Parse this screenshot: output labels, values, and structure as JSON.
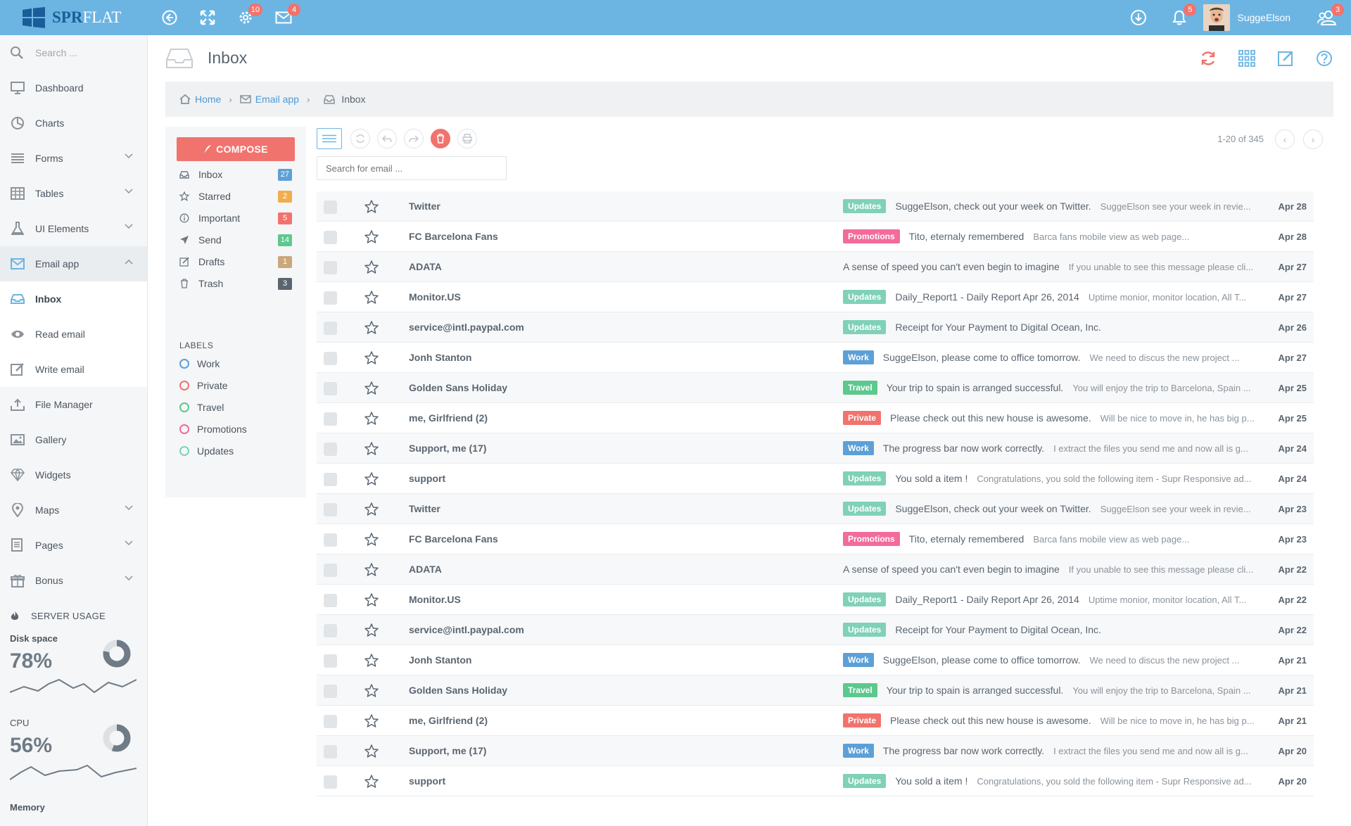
{
  "brand": {
    "part1": "SPR",
    "part2": "FLAT"
  },
  "topbar": {
    "badges": {
      "settings": "10",
      "mail": "4",
      "bell": "5",
      "users": "3"
    },
    "username": "SuggeElson",
    "icons": [
      "back-icon",
      "fullscreen-icon",
      "gear-icon",
      "envelope-icon",
      "download-icon",
      "bell-icon",
      "users-icon"
    ]
  },
  "sidebar": {
    "search_placeholder": "Search ...",
    "items": [
      {
        "label": "Dashboard",
        "icon": "monitor-icon"
      },
      {
        "label": "Charts",
        "icon": "pie-chart-icon"
      },
      {
        "label": "Forms",
        "icon": "list-icon"
      },
      {
        "label": "Tables",
        "icon": "table-icon"
      },
      {
        "label": "UI Elements",
        "icon": "flask-icon"
      },
      {
        "label": "Email app",
        "icon": "envelope-icon"
      }
    ],
    "email_sub": [
      {
        "label": "Inbox",
        "icon": "inbox-icon"
      },
      {
        "label": "Read email",
        "icon": "eye-icon"
      },
      {
        "label": "Write email",
        "icon": "pencil-icon"
      }
    ],
    "items2": [
      {
        "label": "File Manager",
        "icon": "upload-icon"
      },
      {
        "label": "Gallery",
        "icon": "picture-icon"
      },
      {
        "label": "Widgets",
        "icon": "diamond-icon"
      },
      {
        "label": "Maps",
        "icon": "map-pin-icon"
      },
      {
        "label": "Pages",
        "icon": "pages-icon"
      },
      {
        "label": "Bonus",
        "icon": "gift-icon"
      }
    ],
    "server": {
      "title": "SERVER USAGE",
      "disk": {
        "label": "Disk space",
        "pct": "78%",
        "value": 0.78
      },
      "cpu": {
        "label": "CPU",
        "pct": "56%",
        "value": 0.56
      },
      "memory": {
        "label": "Memory"
      }
    }
  },
  "page": {
    "title": "Inbox"
  },
  "breadcrumb": {
    "home": "Home",
    "email": "Email app",
    "current": "Inbox"
  },
  "mailnav": {
    "compose": "COMPOSE",
    "folders": [
      {
        "label": "Inbox",
        "count": "27",
        "color": "#5da0d7",
        "icon": "inbox-icon"
      },
      {
        "label": "Starred",
        "count": "2",
        "color": "#f0ad4e",
        "icon": "star-icon"
      },
      {
        "label": "Important",
        "count": "5",
        "color": "#f1736e",
        "icon": "info-icon"
      },
      {
        "label": "Send",
        "count": "14",
        "color": "#5cc88e",
        "icon": "send-icon"
      },
      {
        "label": "Drafts",
        "count": "1",
        "color": "#c9a87c",
        "icon": "draft-icon"
      },
      {
        "label": "Trash",
        "count": "3",
        "color": "#5a6570",
        "icon": "trash-icon"
      }
    ],
    "labels_title": "LABELS",
    "labels": [
      {
        "label": "Work",
        "color": "#5da0d7"
      },
      {
        "label": "Private",
        "color": "#f1736e"
      },
      {
        "label": "Travel",
        "color": "#5cc88e"
      },
      {
        "label": "Promotions",
        "color": "#f26b9b"
      },
      {
        "label": "Updates",
        "color": "#7fd1b7"
      }
    ]
  },
  "toolbar": {
    "pager": "1-20 of 345",
    "search_placeholder": "Search for email ..."
  },
  "tag_colors": {
    "Updates": "#7fd1b7",
    "Promotions": "#f26b9b",
    "Work": "#5da0d7",
    "Travel": "#5cc88e",
    "Private": "#f1736e"
  },
  "emails": [
    {
      "from": "Twitter",
      "tag": "Updates",
      "subject": "SuggeElson, check out your week on Twitter.",
      "preview": "SuggeElson see your week in revie...",
      "date": "Apr 28"
    },
    {
      "from": "FC Barcelona Fans",
      "tag": "Promotions",
      "subject": "Tito, eternaly remembered",
      "preview": "Barca fans mobile view as web page...",
      "date": "Apr 28"
    },
    {
      "from": "ADATA",
      "tag": "",
      "subject": "A sense of speed you can't even begin to imagine",
      "preview": "If you unable to see this message please cli...",
      "date": "Apr 27"
    },
    {
      "from": "Monitor.US",
      "tag": "Updates",
      "subject": "Daily_Report1 - Daily Report Apr 26, 2014",
      "preview": "Uptime monior, monitor location, All T...",
      "date": "Apr 27"
    },
    {
      "from": "service@intl.paypal.com",
      "tag": "Updates",
      "subject": "Receipt for Your Payment to Digital Ocean, Inc.",
      "preview": "",
      "date": "Apr 26"
    },
    {
      "from": "Jonh Stanton",
      "tag": "Work",
      "subject": "SuggeElson, please come to office tomorrow.",
      "preview": "We need to discus the new project ...",
      "date": "Apr 27"
    },
    {
      "from": "Golden Sans Holiday",
      "tag": "Travel",
      "subject": "Your trip to spain is arranged successful.",
      "preview": "You will enjoy the trip to Barcelona, Spain ...",
      "date": "Apr 25"
    },
    {
      "from": "me, Girlfriend (2)",
      "tag": "Private",
      "subject": "Please check out this new house is awesome.",
      "preview": "Will be nice to move in, he has big p...",
      "date": "Apr 25"
    },
    {
      "from": "Support, me (17)",
      "tag": "Work",
      "subject": "The progress bar now work correctly.",
      "preview": "I extract the files you send me and now all is g...",
      "date": "Apr 24"
    },
    {
      "from": "support",
      "tag": "Updates",
      "subject": "You sold a item !",
      "preview": "Congratulations, you sold the following item - Supr Responsive ad...",
      "date": "Apr 24"
    },
    {
      "from": "Twitter",
      "tag": "Updates",
      "subject": "SuggeElson, check out your week on Twitter.",
      "preview": "SuggeElson see your week in revie...",
      "date": "Apr 23"
    },
    {
      "from": "FC Barcelona Fans",
      "tag": "Promotions",
      "subject": "Tito, eternaly remembered",
      "preview": "Barca fans mobile view as web page...",
      "date": "Apr 23"
    },
    {
      "from": "ADATA",
      "tag": "",
      "subject": "A sense of speed you can't even begin to imagine",
      "preview": "If you unable to see this message please cli...",
      "date": "Apr 22"
    },
    {
      "from": "Monitor.US",
      "tag": "Updates",
      "subject": "Daily_Report1 - Daily Report Apr 26, 2014",
      "preview": "Uptime monior, monitor location, All T...",
      "date": "Apr 22"
    },
    {
      "from": "service@intl.paypal.com",
      "tag": "Updates",
      "subject": "Receipt for Your Payment to Digital Ocean, Inc.",
      "preview": "",
      "date": "Apr 22"
    },
    {
      "from": "Jonh Stanton",
      "tag": "Work",
      "subject": "SuggeElson, please come to office tomorrow.",
      "preview": "We need to discus the new project ...",
      "date": "Apr 21"
    },
    {
      "from": "Golden Sans Holiday",
      "tag": "Travel",
      "subject": "Your trip to spain is arranged successful.",
      "preview": "You will enjoy the trip to Barcelona, Spain ...",
      "date": "Apr 21"
    },
    {
      "from": "me, Girlfriend (2)",
      "tag": "Private",
      "subject": "Please check out this new house is awesome.",
      "preview": "Will be nice to move in, he has big p...",
      "date": "Apr 21"
    },
    {
      "from": "Support, me (17)",
      "tag": "Work",
      "subject": "The progress bar now work correctly.",
      "preview": "I extract the files you send me and now all is g...",
      "date": "Apr 20"
    },
    {
      "from": "support",
      "tag": "Updates",
      "subject": "You sold a item !",
      "preview": "Congratulations, you sold the following item - Supr Responsive ad...",
      "date": "Apr 20"
    }
  ]
}
